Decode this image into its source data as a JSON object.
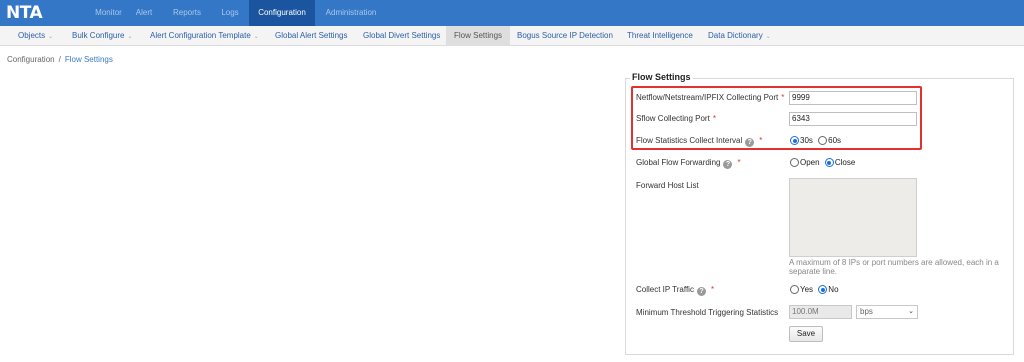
{
  "app": {
    "logo": "NTA"
  },
  "topnav": {
    "items": [
      {
        "label": "Monitor"
      },
      {
        "label": "Alert"
      },
      {
        "label": "Reports"
      },
      {
        "label": "Logs"
      },
      {
        "label": "Configuration"
      },
      {
        "label": "Administration"
      }
    ],
    "active_index": 4
  },
  "subnav": {
    "items": [
      {
        "label": "Objects",
        "has_dropdown": true
      },
      {
        "label": "Bulk Configure",
        "has_dropdown": true
      },
      {
        "label": "Alert Configuration Template",
        "has_dropdown": true
      },
      {
        "label": "Global Alert Settings",
        "has_dropdown": false
      },
      {
        "label": "Global Divert Settings",
        "has_dropdown": false
      },
      {
        "label": "Flow Settings",
        "has_dropdown": false
      },
      {
        "label": "Bogus Source IP Detection",
        "has_dropdown": false
      },
      {
        "label": "Threat Intelligence",
        "has_dropdown": false
      },
      {
        "label": "Data Dictionary",
        "has_dropdown": true
      }
    ],
    "active_index": 5,
    "dropdown_icon": "chevron-down-icon"
  },
  "breadcrumb": {
    "items": [
      "Configuration",
      "Flow Settings"
    ],
    "separator": "/"
  },
  "form": {
    "legend": "Flow Settings",
    "netflow_port": {
      "label": "Netflow/Netstream/IPFIX Collecting Port",
      "required": "*",
      "value": "9999"
    },
    "sflow_port": {
      "label": "Sflow Collecting Port",
      "required": "*",
      "value": "6343"
    },
    "collect_interval": {
      "label": "Flow Statistics Collect Interval",
      "required": "*",
      "help_icon": "?",
      "options": [
        "30s",
        "60s"
      ],
      "selected": "30s"
    },
    "global_forwarding": {
      "label": "Global Flow Forwarding",
      "required": "*",
      "help_icon": "?",
      "options": [
        "Open",
        "Close"
      ],
      "selected": "Close"
    },
    "forward_host_list": {
      "label": "Forward Host List",
      "value": "",
      "hint": "A maximum of 8 IPs or port numbers are allowed, each in a separate line."
    },
    "collect_ip_traffic": {
      "label": "Collect IP Traffic",
      "required": "*",
      "help_icon": "?",
      "options": [
        "Yes",
        "No"
      ],
      "selected": "No"
    },
    "min_threshold": {
      "label": "Minimum Threshold Triggering Statistics",
      "value": "100.0M",
      "unit": "bps"
    },
    "save_label": "Save"
  },
  "colors": {
    "topbar": "#3477c7",
    "topbar_active": "#1b55a0",
    "link": "#2b5fa8",
    "required": "#e0312f",
    "highlight": "#e23131",
    "radio_checked": "#1a6fe0"
  }
}
